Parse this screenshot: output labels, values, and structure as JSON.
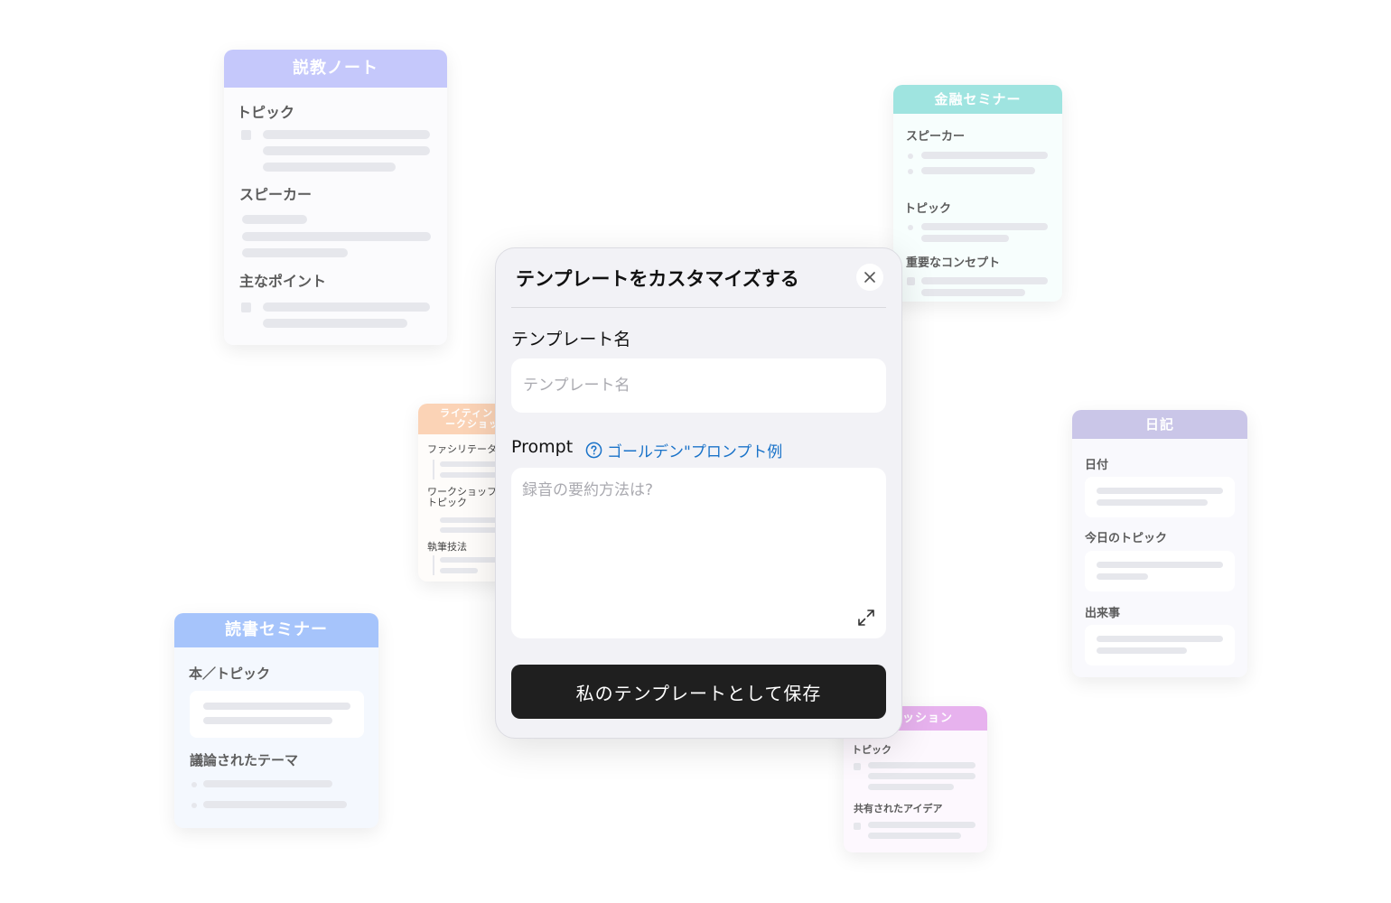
{
  "cards": {
    "sermon": {
      "title": "説教ノート",
      "topic": "トピック",
      "speaker": "スピーカー",
      "main_points": "主なポイント",
      "header_color": "#c5c8fb"
    },
    "finance": {
      "title": "金融セミナー",
      "speaker": "スピーカー",
      "topic": "トピック",
      "key_concepts": "重要なコンセプト",
      "header_color": "#9fe4e0"
    },
    "writing": {
      "title_line1": "ライティン",
      "title_line2": "ークショッ",
      "facilitator": "ファシリテータ",
      "workshop_topic_line1": "ワークショッフ",
      "workshop_topic_line2": "トピック",
      "writing_technique": "執筆技法",
      "header_color": "#fbd3b6"
    },
    "diary": {
      "title": "日記",
      "date": "日付",
      "today_topic": "今日のトピック",
      "events": "出来事",
      "header_color": "#cac6e8"
    },
    "reading": {
      "title": "読書セミナー",
      "book_topic": "本／トピック",
      "themes": "議論されたテーマ",
      "header_color": "#a6c4fb"
    },
    "session": {
      "title": "セッション",
      "topic": "トピック",
      "shared_ideas": "共有されたアイデア",
      "header_color": "#e7b2ee"
    }
  },
  "modal": {
    "title": "テンプレートをカスタマイズする",
    "name_label": "テンプレート名",
    "name_placeholder": "テンプレート名",
    "prompt_label": "Prompt",
    "golden_link": "ゴールデン\"プロンプト例",
    "prompt_placeholder": "録音の要約方法は?",
    "save_button": "私のテンプレートとして保存"
  },
  "icons": {
    "close": "close-icon",
    "help": "help-circle-icon",
    "expand": "expand-icon"
  },
  "colors": {
    "accent_link": "#1a73c9",
    "save_button_bg": "#1f1f1f",
    "modal_bg": "#f2f2f6"
  }
}
